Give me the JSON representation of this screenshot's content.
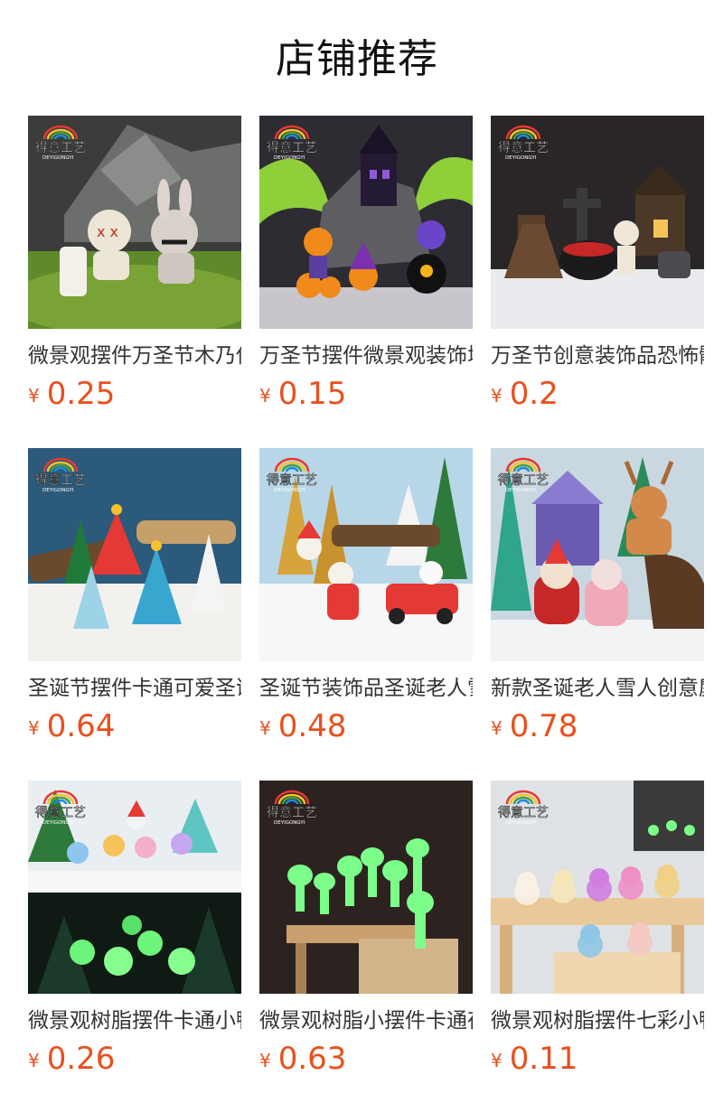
{
  "header": {
    "title": "店铺推荐"
  },
  "brand": {
    "watermark_text": "得意工艺",
    "watermark_sub": "DEYIGONGYI"
  },
  "currency_symbol": "¥",
  "products": [
    {
      "name": "微景观摆件万圣节木乃伊兔子装饰",
      "price": "0.25",
      "scene": "halloween-mummy"
    },
    {
      "name": "万圣节摆件微景观装饰城堡南瓜",
      "price": "0.15",
      "scene": "halloween-castle"
    },
    {
      "name": "万圣节创意装饰品恐怖骷髅",
      "price": "0.2",
      "scene": "halloween-skeleton"
    },
    {
      "name": "圣诞节摆件卡通可爱圣诞树",
      "price": "0.64",
      "scene": "christmas-trees"
    },
    {
      "name": "圣诞节装饰品圣诞老人雪人小火车",
      "price": "0.48",
      "scene": "christmas-train"
    },
    {
      "name": "新款圣诞老人雪人创意麋鹿",
      "price": "0.78",
      "scene": "christmas-reindeer"
    },
    {
      "name": "微景观树脂摆件卡通小鸭子夜光",
      "price": "0.26",
      "scene": "glow-ducks"
    },
    {
      "name": "微景观树脂小摆件卡通夜光精灵",
      "price": "0.63",
      "scene": "glow-spirits"
    },
    {
      "name": "微景观树脂摆件七彩小鸭子",
      "price": "0.11",
      "scene": "color-ducks"
    }
  ]
}
